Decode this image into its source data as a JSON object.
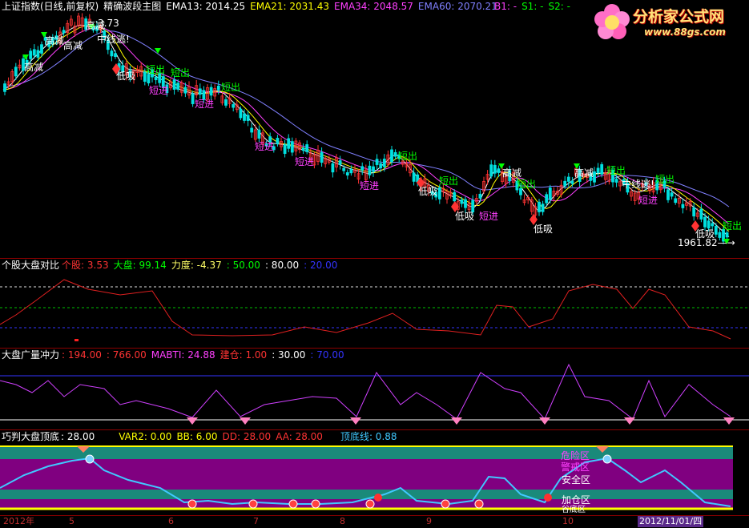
{
  "main": {
    "title": "上证指数(日线,前复权)",
    "indicator": "精确波段主图",
    "ema13": "EMA13: 2014.25",
    "ema21": "EMA21: 2031.43",
    "ema34": "EMA34: 2048.57",
    "ema60": "EMA60: 2070.21",
    "b1": "B1: -",
    "s1": "S1: -",
    "s2": "S2: -",
    "high_value": "3.73",
    "last_price": "1961.82",
    "signals": {
      "high_reduce": "高减",
      "mid_escape": "中线逃!",
      "low_buy": "低吸",
      "short_out": "短出",
      "short_in": "短进"
    }
  },
  "panel2": {
    "title": "个股大盘对比",
    "stock": "个股: 3.53",
    "market": "大盘: 99.14",
    "strength": "力度: -4.37",
    "l50": ": 50.00",
    "l80": ": 80.00",
    "l20": ": 20.00"
  },
  "panel3": {
    "title": "大盘广量冲力",
    "v194": ": 194.00",
    "v766": ": 766.00",
    "mabti": "MABTI: 24.88",
    "build": "建仓: 1.00",
    "v30": ": 30.00",
    "v70": ": 70.00"
  },
  "panel4": {
    "title": "巧判大盘顶底",
    "v28": ": 28.00",
    "var2": "VAR2: 0.00",
    "bb": "BB: 6.00",
    "dd": "DD: 28.00",
    "aa": "AA: 28.00",
    "bottomline": "顶底线: 0.88",
    "zone_danger": "危险区",
    "zone_warn": "警戒区",
    "zone_safe": "安全区",
    "zone_add": "加仓区",
    "zone_bottom": "谷底区"
  },
  "xaxis": {
    "labels": [
      "2012年",
      "5",
      "6",
      "7",
      "8",
      "9",
      "10"
    ],
    "selected_date": "2012/11/01/四"
  },
  "logo": {
    "name": "分析家公式网",
    "url": "www.88gs.com"
  },
  "colors": {
    "background": "#000000",
    "up": "#ff3333",
    "down": "#00e0e0",
    "ema13": "#ffffff",
    "ema21": "#ffff00",
    "ema34": "#ff40ff",
    "ema60": "#8080ff",
    "separator": "#8a0000"
  }
}
